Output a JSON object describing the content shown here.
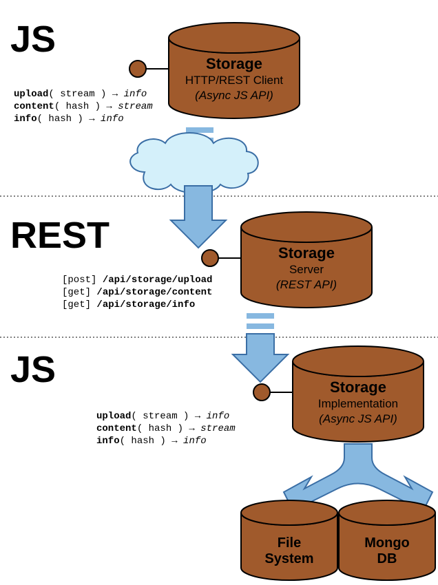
{
  "sections": {
    "top": {
      "label": "JS"
    },
    "middle": {
      "label": "REST"
    },
    "bottom": {
      "label": "JS"
    }
  },
  "cylinders": {
    "client": {
      "title": "Storage",
      "sub": "HTTP/REST Client",
      "api": "(Async JS API)"
    },
    "server": {
      "title": "Storage",
      "sub": "Server",
      "api": "(REST API)"
    },
    "impl": {
      "title": "Storage",
      "sub": "Implementation",
      "api": "(Async JS API)"
    },
    "fs": {
      "line1": "File",
      "line2": "System"
    },
    "mongo": {
      "line1": "Mongo",
      "line2": "DB"
    }
  },
  "jsapi": [
    {
      "fn": "upload",
      "arg": "( stream )",
      "arrow": " → ",
      "ret": "info"
    },
    {
      "fn": "content",
      "arg": "( hash )",
      "arrow": " → ",
      "ret": "stream"
    },
    {
      "fn": "info",
      "arg": "( hash )",
      "arrow": " → ",
      "ret": "info"
    }
  ],
  "restapi": [
    {
      "method": "[post]",
      "path": "/api/storage/upload"
    },
    {
      "method": "[get]",
      "path": "/api/storage/content"
    },
    {
      "method": "[get]",
      "path": "/api/storage/info"
    }
  ]
}
